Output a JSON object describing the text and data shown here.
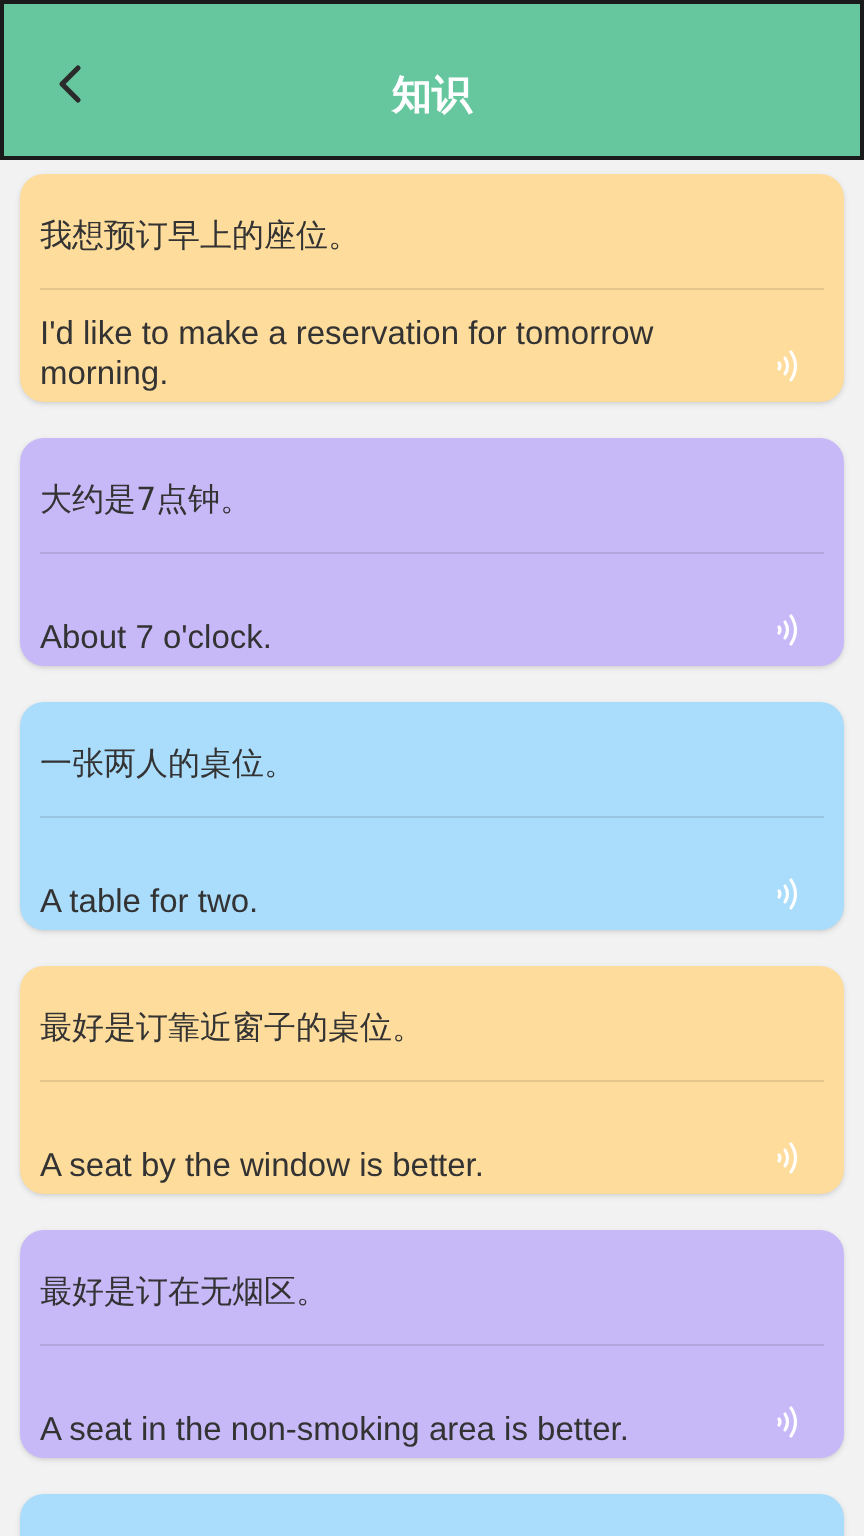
{
  "header": {
    "title": "知识"
  },
  "cards": [
    {
      "chinese": "我想预订早上的座位。",
      "english": "I'd like to make a reservation for tomorrow morning.",
      "color": "#fedc9c"
    },
    {
      "chinese": "大约是7点钟。",
      "english": "About 7 o'clock.",
      "color": "#c7b9f8"
    },
    {
      "chinese": "一张两人的桌位。",
      "english": "A table for two.",
      "color": "#aadcfb"
    },
    {
      "chinese": "最好是订靠近窗子的桌位。",
      "english": "A seat by the window is better.",
      "color": "#fedc9c"
    },
    {
      "chinese": "最好是订在无烟区。",
      "english": "A seat in the non-smoking area is better.",
      "color": "#c7b9f8"
    },
    {
      "color": "#aadcfb"
    }
  ]
}
